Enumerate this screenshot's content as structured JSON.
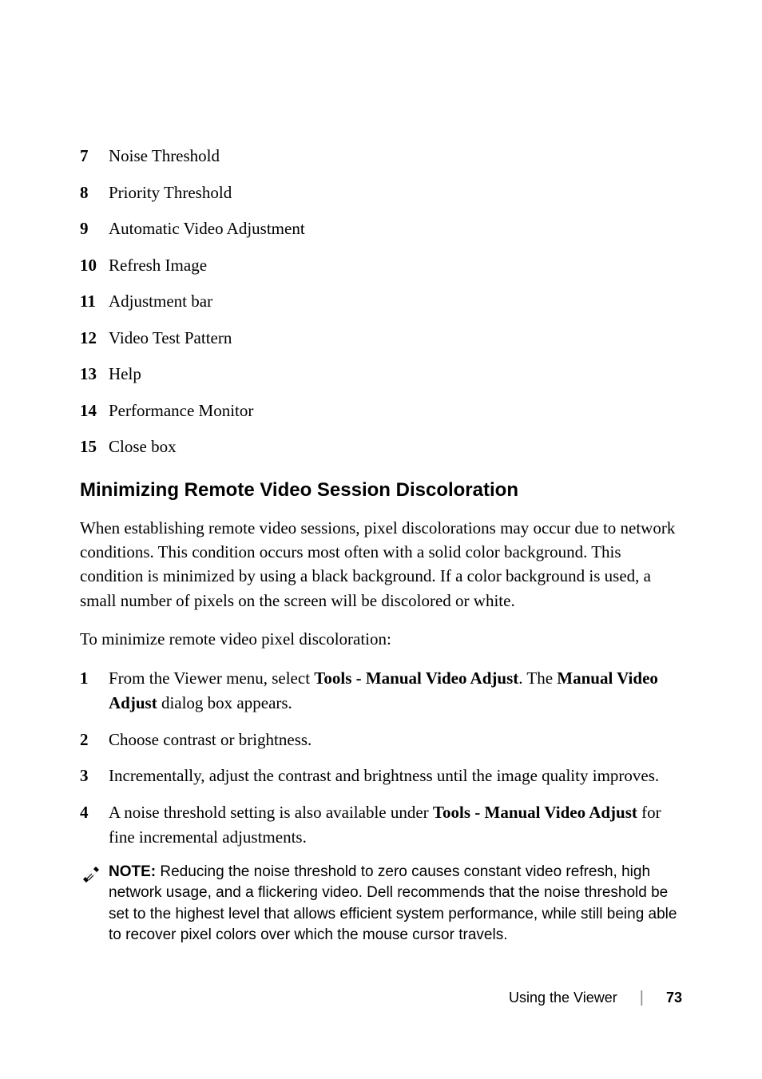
{
  "list1": [
    {
      "n": "7",
      "t": "Noise Threshold"
    },
    {
      "n": "8",
      "t": "Priority Threshold"
    },
    {
      "n": "9",
      "t": "Automatic Video Adjustment"
    },
    {
      "n": "10",
      "t": "Refresh Image"
    },
    {
      "n": "11",
      "t": "Adjustment bar"
    },
    {
      "n": "12",
      "t": "Video Test Pattern"
    },
    {
      "n": "13",
      "t": "Help"
    },
    {
      "n": "14",
      "t": "Performance Monitor"
    },
    {
      "n": "15",
      "t": "Close box"
    }
  ],
  "heading": "Minimizing Remote Video Session Discoloration",
  "para1": "When establishing remote video sessions, pixel discolorations may occur due to network conditions. This condition occurs most often with a solid color background. This condition is minimized by using a black background. If a color background is used, a small number of pixels on the screen will be discolored or white.",
  "para2": "To minimize remote video pixel discoloration:",
  "steps": {
    "s1": {
      "n": "1",
      "pre": "From the Viewer menu, select ",
      "b1": "Tools - Manual Video Adjust",
      "mid": ". The ",
      "b2": "Manual Video Adjust",
      "post": " dialog box appears."
    },
    "s2": {
      "n": "2",
      "t": "Choose contrast or brightness."
    },
    "s3": {
      "n": "3",
      "t": "Incrementally, adjust the contrast and brightness until the image quality improves."
    },
    "s4": {
      "n": "4",
      "pre": "A noise threshold setting is also available under ",
      "b1": "Tools - Manual Video Adjust",
      "post": " for fine incremental adjustments."
    }
  },
  "note": {
    "label": "NOTE: ",
    "text": "Reducing the noise threshold to zero causes constant video refresh, high network usage, and a flickering video. Dell recommends that the noise threshold be set to the highest level that allows efficient system performance, while still being able to recover pixel colors over which the mouse cursor travels."
  },
  "footer": {
    "section": "Using the Viewer",
    "page": "73"
  }
}
